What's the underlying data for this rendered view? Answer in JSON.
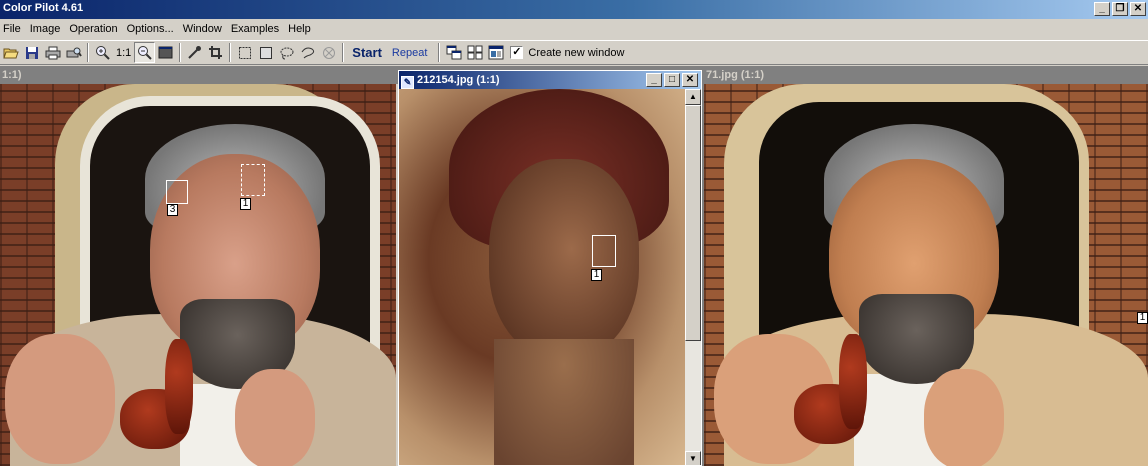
{
  "app": {
    "title": "Color Pilot 4.61",
    "window_buttons": [
      "_",
      "❐",
      "✕"
    ]
  },
  "menu": [
    "File",
    "Image",
    "Operation",
    "Options...",
    "Window",
    "Examples",
    "Help"
  ],
  "toolbar": {
    "zoom_label": "1:1",
    "start_label": "Start",
    "repeat_label": "Repeat",
    "create_new_window_label": "Create new window",
    "create_new_window_checked": true
  },
  "windows": {
    "left": {
      "caption": "1:1)"
    },
    "center": {
      "caption": "212154.jpg (1:1)",
      "buttons": [
        "_",
        "□",
        "✕"
      ],
      "marker_label": "1"
    },
    "right": {
      "caption": "71.jpg (1:1)",
      "marker_label": "1"
    }
  },
  "left_markers": [
    {
      "label": "3"
    },
    {
      "label": "1"
    }
  ],
  "colors": {
    "title_gradient_start": "#0a246a",
    "title_gradient_end": "#a6caf0",
    "face_background": "#d4d0c8",
    "start_text": "#0a246a"
  }
}
